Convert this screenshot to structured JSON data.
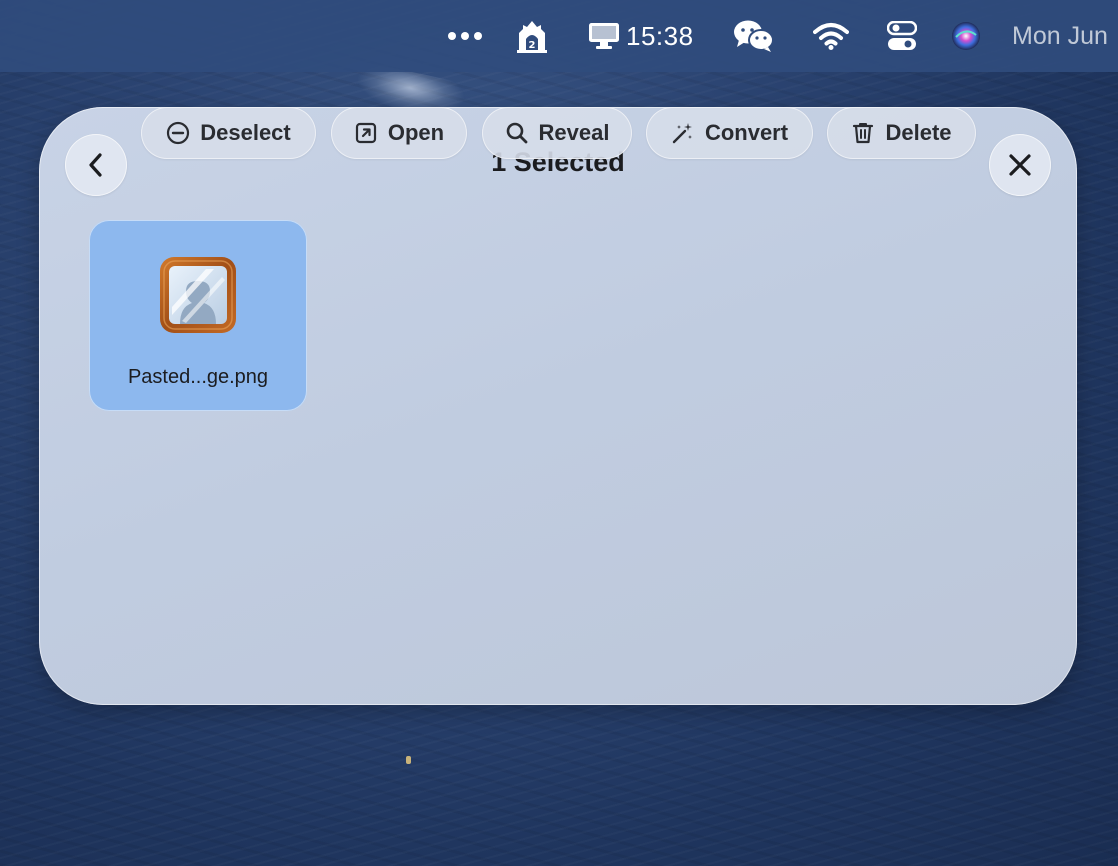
{
  "menubar": {
    "overflow_icon": "ellipsis-icon",
    "app_icon": "castle-app-icon",
    "display_icon": "monitor-icon",
    "time": "15:38",
    "wechat_icon": "wechat-icon",
    "wifi_icon": "wifi-icon",
    "control_center_icon": "control-center-icon",
    "siri_icon": "siri-icon",
    "date": "Mon Jun"
  },
  "panel": {
    "title": "1 Selected",
    "back_icon": "chevron-left-icon",
    "close_icon": "close-icon",
    "files": [
      {
        "name": "Pasted...ge.png",
        "icon": "image-file-icon",
        "selected": true
      }
    ],
    "actions": [
      {
        "label": "Deselect",
        "icon": "minus-circle-icon"
      },
      {
        "label": "Open",
        "icon": "open-external-icon"
      },
      {
        "label": "Reveal",
        "icon": "search-icon"
      },
      {
        "label": "Convert",
        "icon": "magic-wand-icon"
      },
      {
        "label": "Delete",
        "icon": "trash-icon"
      }
    ]
  },
  "colors": {
    "selection": "#8db8ee",
    "panel": "#c4cfe2",
    "menubar": "#304c7d"
  }
}
